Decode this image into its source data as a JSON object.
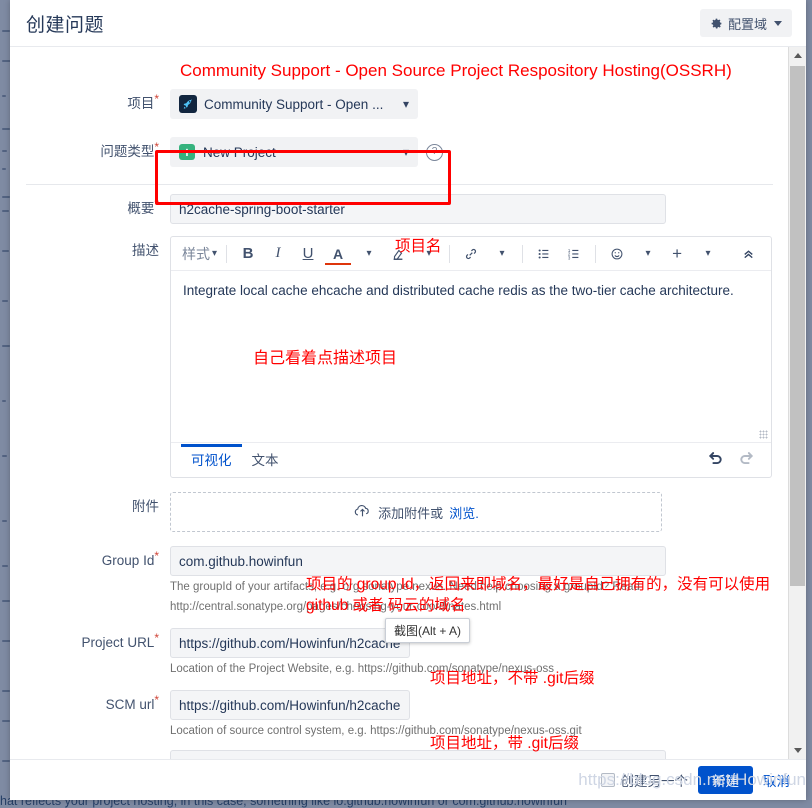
{
  "header": {
    "title": "创建问题",
    "config_button": "配置域",
    "gear_icon": "gear-icon",
    "caret_icon": "chevron-down-icon"
  },
  "annotations": {
    "project_banner": "Community Support - Open Source Project Respository Hosting(OSSRH)",
    "summary_note": "项目名",
    "description_note": "自己看着点描述项目",
    "groupid_note_line1": "项目的 group Id，返回来即域名，最好是自己拥有的，没有可以使用",
    "groupid_note_line2": "github 或者 码云的域名",
    "project_url_note": "项目地址，不带 .git后缀",
    "scm_url_note": "项目地址，带 .git后缀"
  },
  "fields": {
    "project": {
      "label": "项目",
      "required": "*",
      "value": "Community Support - Open ...",
      "icon": "rocket-icon",
      "chevron": "chevron-down-icon"
    },
    "issue_type": {
      "label": "问题类型",
      "required": "*",
      "value": "New Project",
      "icon": "plus-square-icon",
      "chevron": "chevron-down-icon",
      "help_icon": "question-circle-icon"
    },
    "summary": {
      "label": "概要",
      "required": "*",
      "value": "h2cache-spring-boot-starter",
      "placeholder": ""
    },
    "description": {
      "label": "描述",
      "body_text": "Integrate local cache ehcache and distributed cache redis as the two-tier cache architecture.",
      "toolbar": {
        "style": "样式",
        "bold": "B",
        "italic": "I",
        "underline": "U",
        "text_color": "A",
        "highlight": "highlight-icon",
        "link": "link-icon",
        "bullet_list": "bullet-list-icon",
        "numbered_list": "numbered-list-icon",
        "emoji": "emoji-icon",
        "insert_more": "+",
        "collapse": "chevron-double-up-icon"
      },
      "tabs": [
        {
          "label": "可视化",
          "active": true
        },
        {
          "label": "文本",
          "active": false
        }
      ],
      "undo_icon": "undo-icon",
      "redo_icon": "redo-icon"
    },
    "attachment": {
      "label": "附件",
      "drop_text": "添加附件或",
      "browse_link": "浏览.",
      "upload_icon": "upload-cloud-icon"
    },
    "group_id": {
      "label": "Group Id",
      "required": "*",
      "value": "com.github.howinfun",
      "hint_line1": "The groupId of your artifacts, e.g. org.sonatype.nexus. Need help choosing a groupId? Read",
      "hint_line2": "http://central.sonatype.org/pages/choosing-your-coordinates.html"
    },
    "project_url": {
      "label": "Project URL",
      "required": "*",
      "value": "https://github.com/Howinfun/h2cache",
      "hint": "Location of the Project Website, e.g. https://github.com/sonatype/nexus-oss"
    },
    "scm_url": {
      "label": "SCM url",
      "required": "*",
      "value": "https://github.com/Howinfun/h2cache",
      "hint": "Location of source control system, e.g. https://github.com/sonatype/nexus-oss.git"
    }
  },
  "tooltip": {
    "text": "截图(Alt + A)"
  },
  "footer": {
    "create_another_label": "创建另一个",
    "submit_label": "新建",
    "cancel_label": "取消"
  },
  "watermark": "https://blog.csdn.net/Howinfun",
  "background_text": "hat reflects your project hosting, in this case, something like io.github.howinfun or com.github.howinfun",
  "colors": {
    "annotation_red": "#ff0000",
    "primary_blue": "#0052cc",
    "link_blue": "#0052cc",
    "required_red": "#d04437",
    "new_project_green": "#36b37e"
  }
}
